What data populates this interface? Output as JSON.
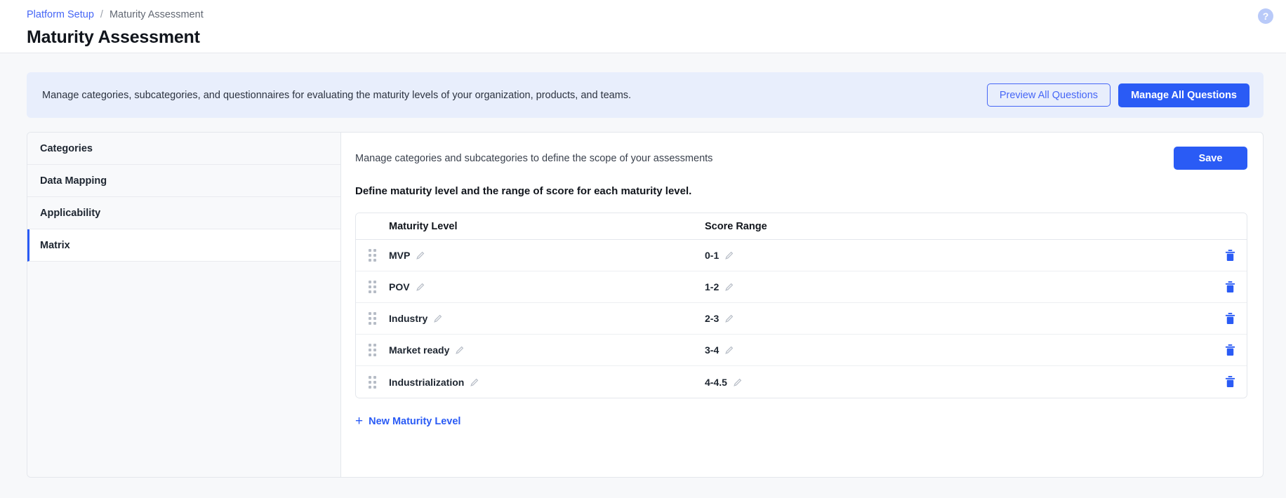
{
  "breadcrumb": {
    "parent": "Platform Setup",
    "separator": "/",
    "current": "Maturity Assessment"
  },
  "header": {
    "title": "Maturity Assessment",
    "help_icon_glyph": "?",
    "help_icon_name": "help-circle-icon"
  },
  "banner": {
    "text": "Manage categories, subcategories, and questionnaires for evaluating the maturity levels of your organization, products, and teams.",
    "preview_label": "Preview All Questions",
    "manage_label": "Manage All Questions",
    "background": "#e8eefc"
  },
  "sidebar": {
    "items": [
      {
        "label": "Categories",
        "active": false
      },
      {
        "label": "Data Mapping",
        "active": false
      },
      {
        "label": "Applicability",
        "active": false
      },
      {
        "label": "Matrix",
        "active": true
      }
    ],
    "active_indicator_color": "#2a5bf5"
  },
  "main": {
    "description": "Manage categories and subcategories to define the scope of your assessments",
    "save_label": "Save",
    "section_title": "Define maturity level and the range of score for each maturity level.",
    "add_link_label": "New Maturity Level",
    "add_link_glyph": "+"
  },
  "table": {
    "columns": [
      "Maturity Level",
      "Score Range"
    ],
    "rows": [
      {
        "level": "MVP",
        "score": "0-1"
      },
      {
        "level": "POV",
        "score": "1-2"
      },
      {
        "level": "Industry",
        "score": "2-3"
      },
      {
        "level": "Market ready",
        "score": "3-4"
      },
      {
        "level": "Industrialization",
        "score": "4-4.5"
      }
    ],
    "row_icons": {
      "drag": "drag-handle-icon",
      "edit": "pencil-edit-icon",
      "delete": "trash-delete-icon"
    }
  },
  "colors": {
    "primary": "#2a5bf5",
    "link": "#4666f6",
    "banner_bg": "#e8eefc",
    "page_bg": "#f7f8fa",
    "delete": "#2a5bf5"
  }
}
